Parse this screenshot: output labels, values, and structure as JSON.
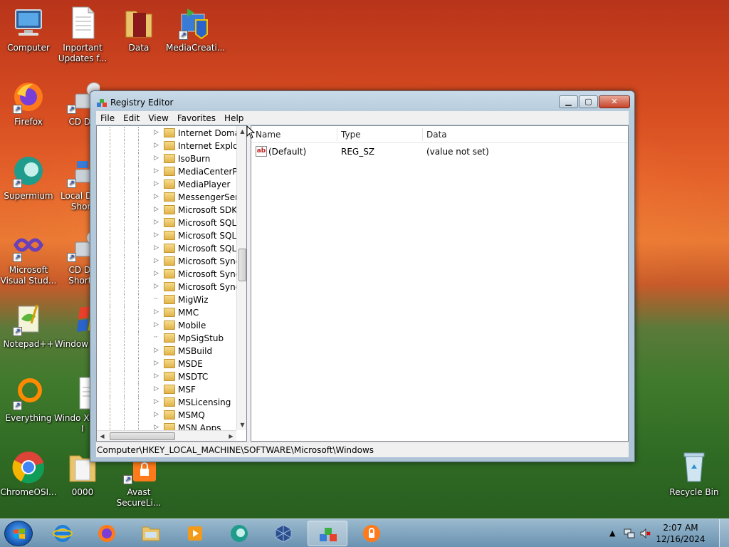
{
  "desktop": {
    "icons": [
      {
        "label": "Computer"
      },
      {
        "label": "Inportant Updates f..."
      },
      {
        "label": "Data"
      },
      {
        "label": "MediaCreati..."
      },
      {
        "label": "Firefox"
      },
      {
        "label": "CD Dri"
      },
      {
        "label": "Supermium"
      },
      {
        "label": "Local Dis - Short"
      },
      {
        "label": "Microsoft Visual Stud..."
      },
      {
        "label": "CD Dri Shorto"
      },
      {
        "label": "Notepad++"
      },
      {
        "label": "Window Setu"
      },
      {
        "label": "Everything"
      },
      {
        "label": "Windo XP.exe I"
      },
      {
        "label": "ChromeOSI..."
      },
      {
        "label": "0000"
      },
      {
        "label": "Avast SecureLi..."
      },
      {
        "label": "Recycle Bin"
      }
    ]
  },
  "window": {
    "title": "Registry Editor",
    "menu": [
      "File",
      "Edit",
      "View",
      "Favorites",
      "Help"
    ],
    "tree_items": [
      "Internet Domai",
      "Internet Explore",
      "IsoBurn",
      "MediaCenterPe",
      "MediaPlayer",
      "MessengerServ",
      "Microsoft SDKs",
      "Microsoft SQL",
      "Microsoft SQL",
      "Microsoft SQL",
      "Microsoft Sync",
      "Microsoft Sync",
      "Microsoft Sync",
      "MigWiz",
      "MMC",
      "Mobile",
      "MpSigStub",
      "MSBuild",
      "MSDE",
      "MSDTC",
      "MSF",
      "MSLicensing",
      "MSMQ",
      "MSN Apps"
    ],
    "tree_expandable": [
      true,
      true,
      true,
      true,
      true,
      true,
      true,
      true,
      true,
      true,
      true,
      true,
      true,
      false,
      true,
      true,
      false,
      true,
      true,
      true,
      true,
      true,
      true,
      true
    ],
    "columns": {
      "name": "Name",
      "type": "Type",
      "data": "Data"
    },
    "values": [
      {
        "name": "(Default)",
        "type": "REG_SZ",
        "data": "(value not set)"
      }
    ],
    "status_path": "Computer\\HKEY_LOCAL_MACHINE\\SOFTWARE\\Microsoft\\Windows"
  },
  "taskbar": {
    "time": "2:07 AM",
    "date": "12/16/2024"
  }
}
